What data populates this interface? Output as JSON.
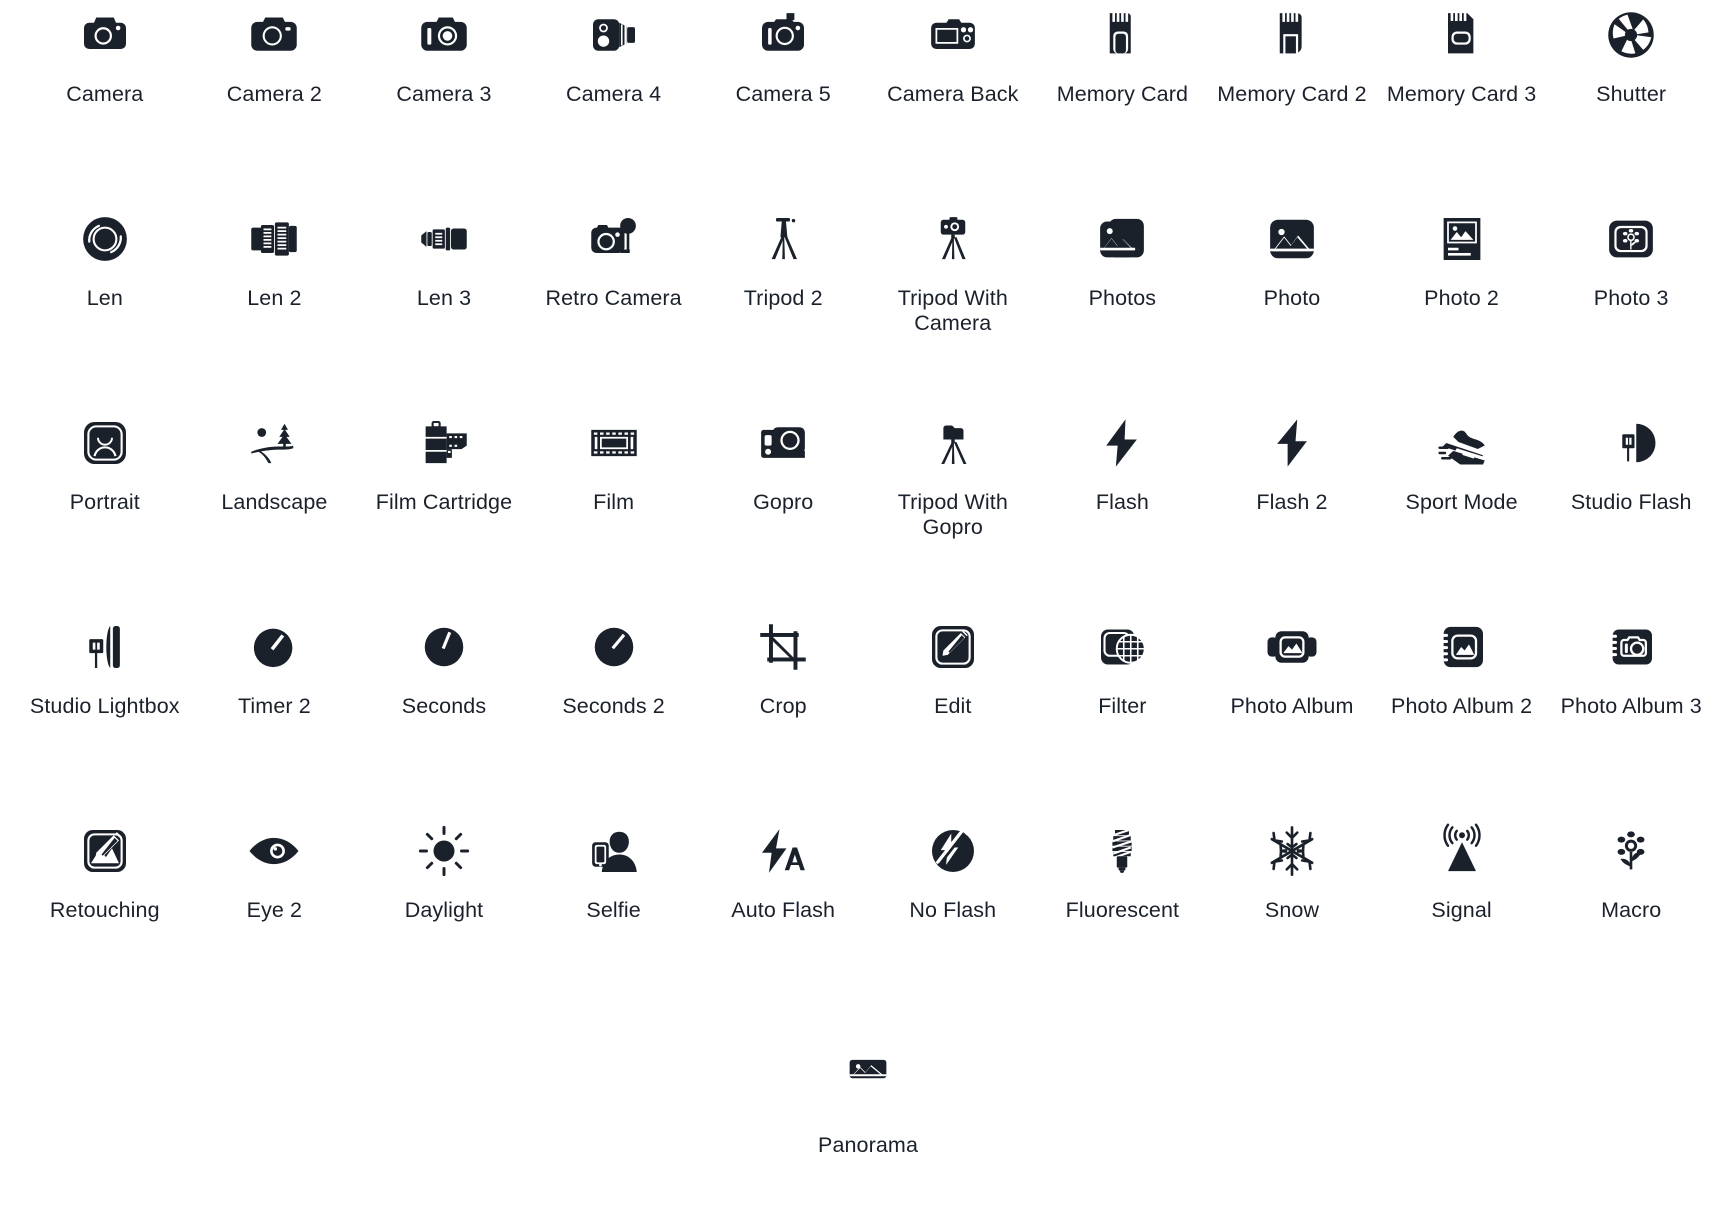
{
  "page": {
    "background_color": "#ffffff",
    "icon_color": "#1b212b",
    "label_color": "#1b212b",
    "columns": 10
  },
  "icons": [
    {
      "label": "Camera",
      "icon": "camera-icon"
    },
    {
      "label": "Camera 2",
      "icon": "camera-2-icon"
    },
    {
      "label": "Camera 3",
      "icon": "camera-3-icon"
    },
    {
      "label": "Camera 4",
      "icon": "camera-4-icon"
    },
    {
      "label": "Camera 5",
      "icon": "camera-5-icon"
    },
    {
      "label": "Camera Back",
      "icon": "camera-back-icon"
    },
    {
      "label": "Memory Card",
      "icon": "memory-card-icon"
    },
    {
      "label": "Memory Card 2",
      "icon": "memory-card-2-icon"
    },
    {
      "label": "Memory Card 3",
      "icon": "memory-card-3-icon"
    },
    {
      "label": "Shutter",
      "icon": "shutter-icon"
    },
    {
      "label": "Len",
      "icon": "len-icon"
    },
    {
      "label": "Len 2",
      "icon": "len-2-icon"
    },
    {
      "label": "Len 3",
      "icon": "len-3-icon"
    },
    {
      "label": "Retro Camera",
      "icon": "retro-camera-icon"
    },
    {
      "label": "Tripod 2",
      "icon": "tripod-2-icon"
    },
    {
      "label": "Tripod With Camera",
      "icon": "tripod-with-camera-icon"
    },
    {
      "label": "Photos",
      "icon": "photos-icon"
    },
    {
      "label": "Photo",
      "icon": "photo-icon"
    },
    {
      "label": "Photo 2",
      "icon": "photo-2-icon"
    },
    {
      "label": "Photo 3",
      "icon": "photo-3-icon"
    },
    {
      "label": "Portrait",
      "icon": "portrait-icon"
    },
    {
      "label": "Landscape",
      "icon": "landscape-icon"
    },
    {
      "label": "Film Cartridge",
      "icon": "film-cartridge-icon"
    },
    {
      "label": "Film",
      "icon": "film-icon"
    },
    {
      "label": "Gopro",
      "icon": "gopro-icon"
    },
    {
      "label": "Tripod With Gopro",
      "icon": "tripod-with-gopro-icon"
    },
    {
      "label": "Flash",
      "icon": "flash-icon"
    },
    {
      "label": "Flash 2",
      "icon": "flash-2-icon"
    },
    {
      "label": "Sport Mode",
      "icon": "sport-mode-icon"
    },
    {
      "label": "Studio Flash",
      "icon": "studio-flash-icon"
    },
    {
      "label": "Studio Lightbox",
      "icon": "studio-lightbox-icon"
    },
    {
      "label": "Timer 2",
      "icon": "timer-2-icon"
    },
    {
      "label": "Seconds",
      "icon": "seconds-icon"
    },
    {
      "label": "Seconds 2",
      "icon": "seconds-2-icon"
    },
    {
      "label": "Crop",
      "icon": "crop-icon"
    },
    {
      "label": "Edit",
      "icon": "edit-icon"
    },
    {
      "label": "Filter",
      "icon": "filter-icon"
    },
    {
      "label": "Photo Album",
      "icon": "photo-album-icon"
    },
    {
      "label": "Photo Album 2",
      "icon": "photo-album-2-icon"
    },
    {
      "label": "Photo Album 3",
      "icon": "photo-album-3-icon"
    },
    {
      "label": "Retouching",
      "icon": "retouching-icon"
    },
    {
      "label": "Eye 2",
      "icon": "eye-2-icon"
    },
    {
      "label": "Daylight",
      "icon": "daylight-icon"
    },
    {
      "label": "Selfie",
      "icon": "selfie-icon"
    },
    {
      "label": "Auto Flash",
      "icon": "auto-flash-icon"
    },
    {
      "label": "No Flash",
      "icon": "no-flash-icon"
    },
    {
      "label": "Fluorescent",
      "icon": "fluorescent-icon"
    },
    {
      "label": "Snow",
      "icon": "snow-icon"
    },
    {
      "label": "Signal",
      "icon": "signal-icon"
    },
    {
      "label": "Macro",
      "icon": "macro-icon"
    }
  ],
  "trailing_icons": [
    {
      "label": "Panorama",
      "icon": "panorama-icon"
    }
  ]
}
